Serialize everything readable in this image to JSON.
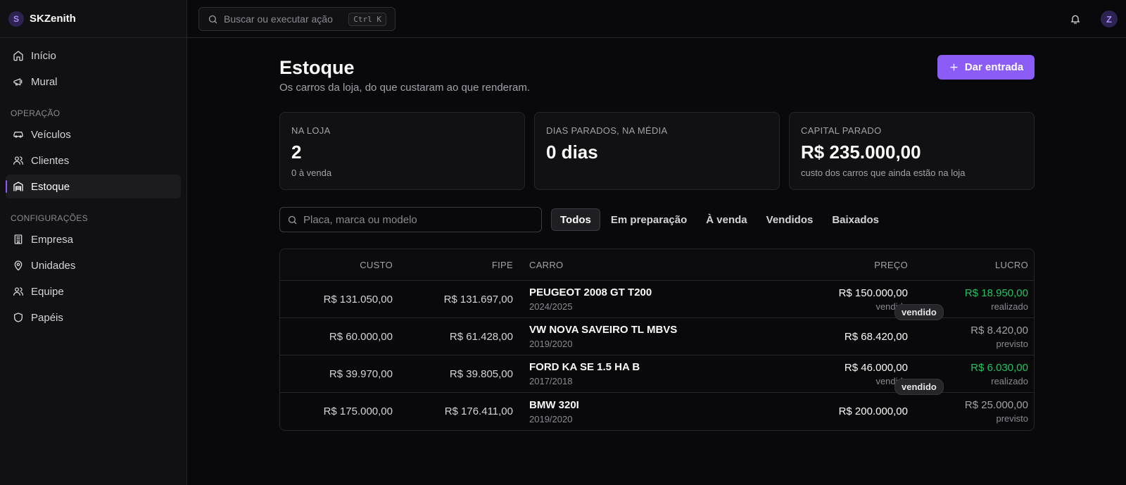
{
  "brand": {
    "logo_letter": "S",
    "name": "SKZenith"
  },
  "sidebar": {
    "items_top": [
      {
        "label": "Início",
        "icon": "home-icon"
      },
      {
        "label": "Mural",
        "icon": "megaphone-icon"
      }
    ],
    "section_operacao": "OPERAÇÃO",
    "items_operacao": [
      {
        "label": "Veículos",
        "icon": "car-icon"
      },
      {
        "label": "Clientes",
        "icon": "users-icon"
      },
      {
        "label": "Estoque",
        "icon": "warehouse-icon",
        "active": true
      }
    ],
    "section_config": "CONFIGURAÇÕES",
    "items_config": [
      {
        "label": "Empresa",
        "icon": "building-icon"
      },
      {
        "label": "Unidades",
        "icon": "map-pin-icon"
      },
      {
        "label": "Equipe",
        "icon": "users-icon"
      },
      {
        "label": "Papéis",
        "icon": "shield-icon"
      }
    ]
  },
  "topbar": {
    "search_placeholder": "Buscar ou executar ação",
    "shortcut": "Ctrl K",
    "avatar_letter": "Z"
  },
  "page": {
    "title": "Estoque",
    "subtitle": "Os carros da loja, do que custaram ao que renderam.",
    "primary_button": "Dar entrada"
  },
  "stats": [
    {
      "label": "NA LOJA",
      "value": "2",
      "desc": "0 à venda"
    },
    {
      "label": "DIAS PARADOS, NA MÉDIA",
      "value": "0 dias",
      "desc": ""
    },
    {
      "label": "CAPITAL PARADO",
      "value": "R$ 235.000,00",
      "desc": "custo dos carros que ainda estão na loja"
    }
  ],
  "filters": {
    "search_placeholder": "Placa, marca ou modelo",
    "tabs": [
      "Todos",
      "Em preparação",
      "À venda",
      "Vendidos",
      "Baixados"
    ],
    "active_tab": "Todos"
  },
  "table": {
    "headers": {
      "custo": "CUSTO",
      "fipe": "FIPE",
      "carro": "CARRO",
      "preco": "PREÇO",
      "lucro": "LUCRO"
    },
    "rows": [
      {
        "custo": "R$ 131.050,00",
        "fipe": "R$ 131.697,00",
        "carro": "PEUGEOT 2008 GT T200",
        "ano": "2024/2025",
        "badge": "vendido",
        "preco": "R$ 150.000,00",
        "preco_sub": "vendido",
        "lucro": "R$ 18.950,00",
        "lucro_sub": "realizado",
        "lucro_color": "#22c55e"
      },
      {
        "custo": "R$ 60.000,00",
        "fipe": "R$ 61.428,00",
        "carro": "VW NOVA SAVEIRO TL MBVS",
        "ano": "2019/2020",
        "badge": "",
        "preco": "R$ 68.420,00",
        "preco_sub": "",
        "lucro": "R$ 8.420,00",
        "lucro_sub": "previsto",
        "lucro_color": "#a1a1aa"
      },
      {
        "custo": "R$ 39.970,00",
        "fipe": "R$ 39.805,00",
        "carro": "FORD KA SE 1.5 HA B",
        "ano": "2017/2018",
        "badge": "vendido",
        "preco": "R$ 46.000,00",
        "preco_sub": "vendido",
        "lucro": "R$ 6.030,00",
        "lucro_sub": "realizado",
        "lucro_color": "#22c55e"
      },
      {
        "custo": "R$ 175.000,00",
        "fipe": "R$ 176.411,00",
        "carro": "BMW 320I",
        "ano": "2019/2020",
        "badge": "",
        "preco": "R$ 200.000,00",
        "preco_sub": "",
        "lucro": "R$ 25.000,00",
        "lucro_sub": "previsto",
        "lucro_color": "#a1a1aa"
      }
    ]
  },
  "colors": {
    "accent": "#8b5cf6",
    "positive": "#22c55e",
    "background": "#09090b"
  }
}
